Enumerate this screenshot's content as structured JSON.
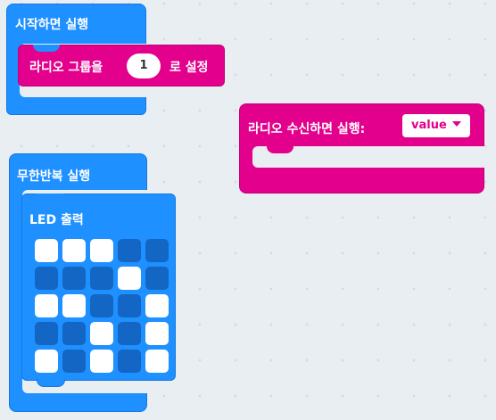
{
  "on_start": {
    "label": "시작하면 실행",
    "radio_group": {
      "label_before": "라디오 그룹을",
      "value": "1",
      "label_after": "로 설정"
    }
  },
  "forever": {
    "label": "무한반복 실행",
    "show_leds": {
      "label": "LED 출력",
      "grid": [
        [
          1,
          1,
          1,
          0,
          0
        ],
        [
          0,
          0,
          0,
          1,
          0
        ],
        [
          1,
          1,
          0,
          0,
          1
        ],
        [
          0,
          0,
          1,
          0,
          1
        ],
        [
          1,
          0,
          1,
          0,
          1
        ]
      ]
    }
  },
  "on_radio_received": {
    "label": "라디오 수신하면 실행:",
    "dropdown_value": "value"
  },
  "colors": {
    "basic_blue": "#1e90ff",
    "radio_pink": "#e3008c",
    "led_on": "#ffffff",
    "led_off": "#1466c4",
    "workspace": "#e9eef2"
  }
}
